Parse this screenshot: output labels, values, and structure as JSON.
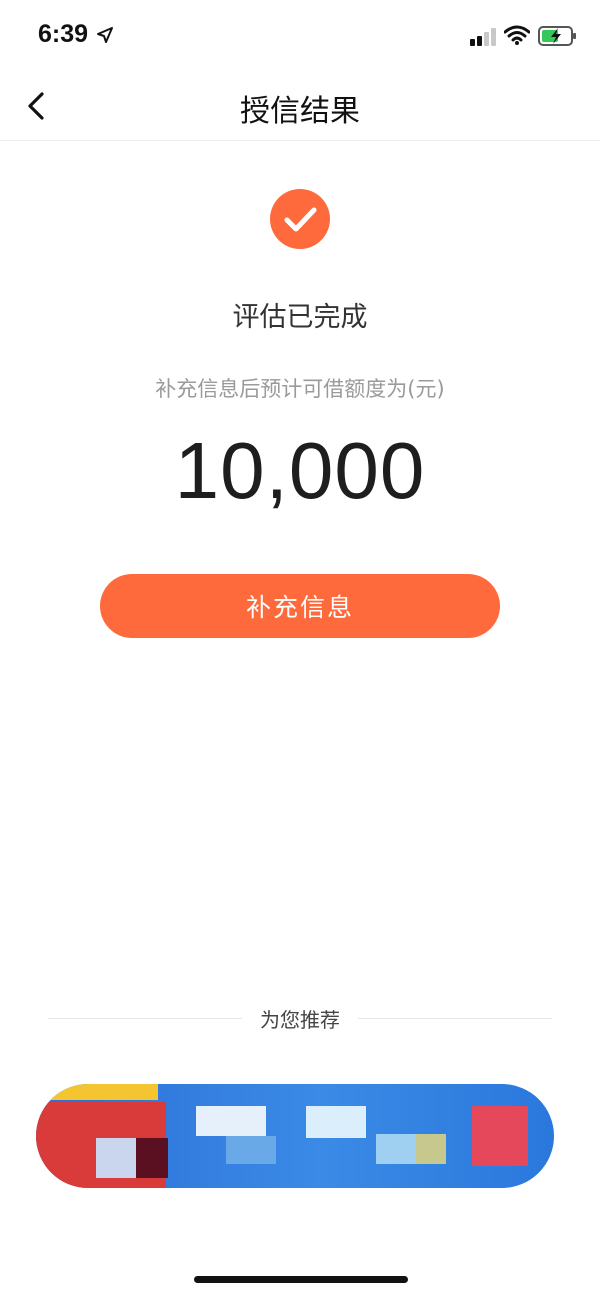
{
  "status_bar": {
    "time": "6:39",
    "icons": [
      "location-arrow-icon",
      "cellular-signal-icon",
      "wifi-icon",
      "battery-charging-icon"
    ]
  },
  "nav": {
    "title": "授信结果",
    "back_icon": "chevron-left-icon"
  },
  "result": {
    "icon": "check-circle-icon",
    "title": "评估已完成",
    "amount_label": "补充信息后预计可借额度为(元)",
    "amount": "10,000"
  },
  "actions": {
    "primary_label": "补充信息"
  },
  "recommend": {
    "title": "为您推荐"
  },
  "colors": {
    "accent": "#ff6a3d",
    "banner_blue": "#2b6fd8",
    "muted_text": "#9a9a9a"
  }
}
